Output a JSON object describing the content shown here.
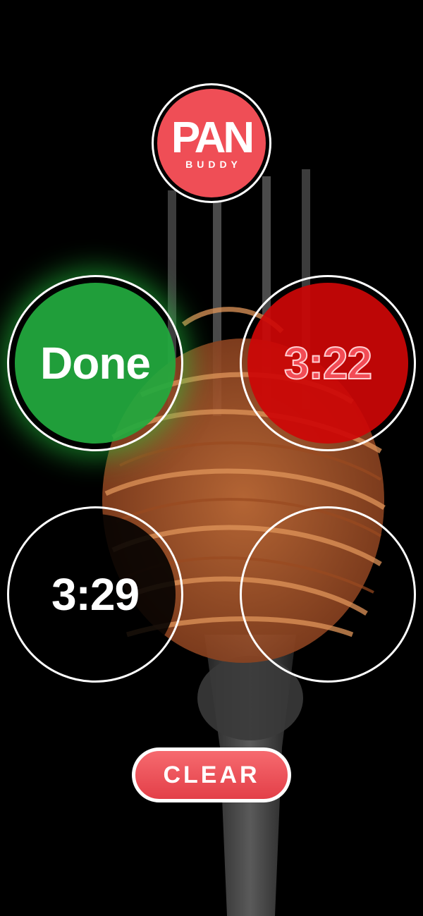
{
  "logo": {
    "title": "PAN",
    "subtitle": "BUDDY",
    "color": "#ef4e56"
  },
  "timers": [
    {
      "label": "Done",
      "state": "done",
      "color": "#22aa3e"
    },
    {
      "label": "3:22",
      "state": "alert",
      "color": "#cd0606"
    },
    {
      "label": "3:29",
      "state": "running",
      "color": "#000000"
    },
    {
      "label": "",
      "state": "empty",
      "color": ""
    }
  ],
  "clear_button": {
    "label": "CLEAR",
    "color": "#ef4e56"
  },
  "background": {
    "icon": "fork-with-spaghetti-image"
  }
}
